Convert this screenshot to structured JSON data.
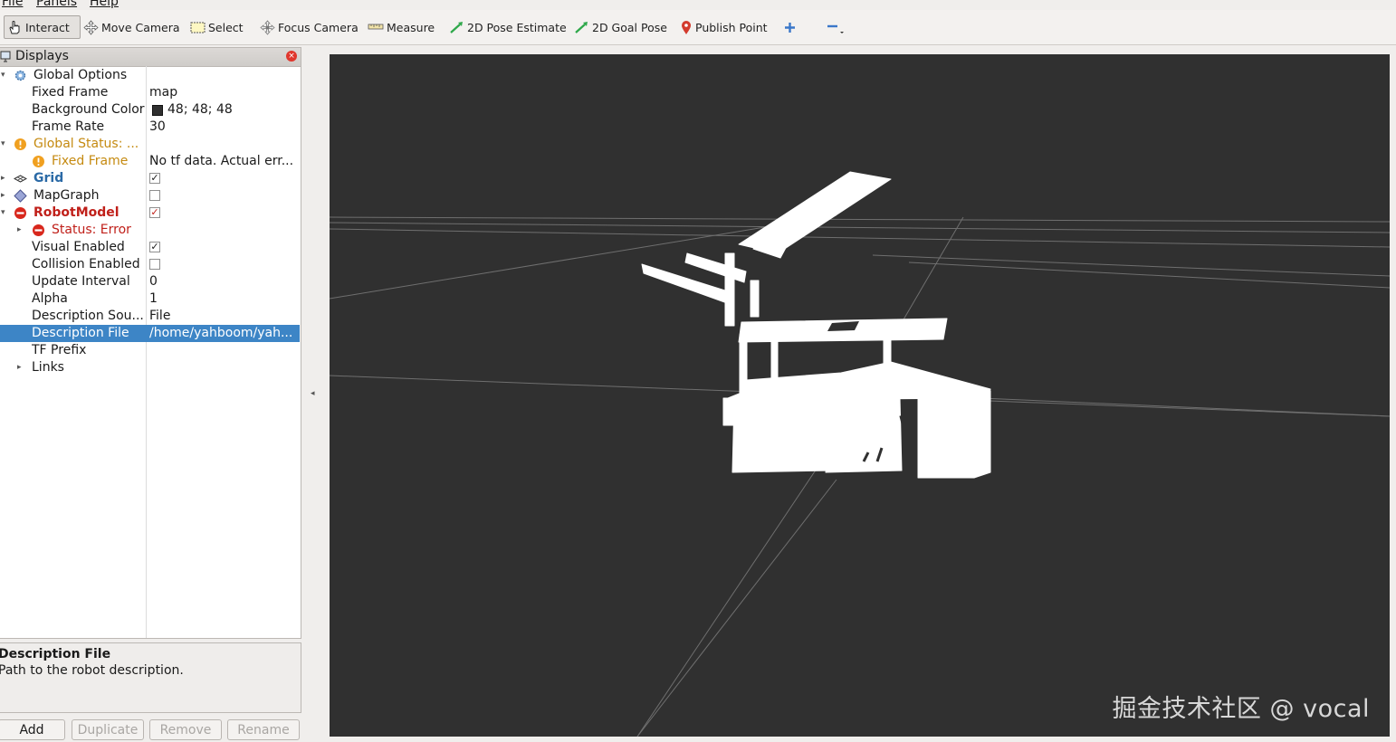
{
  "menu": {
    "items": [
      "File",
      "Panels",
      "Help"
    ]
  },
  "toolbar": {
    "interact": "Interact",
    "move_camera": "Move Camera",
    "select": "Select",
    "focus_camera": "Focus Camera",
    "measure": "Measure",
    "pose_estimate": "2D Pose Estimate",
    "goal_pose": "2D Goal Pose",
    "publish_point": "Publish Point"
  },
  "displays": {
    "title": "Displays",
    "rows": [
      {
        "name": "Global Options",
        "value": ""
      },
      {
        "name": "Fixed Frame",
        "value": "map"
      },
      {
        "name": "Background Color",
        "value": "48; 48; 48"
      },
      {
        "name": "Frame Rate",
        "value": "30"
      },
      {
        "name": "Global Status: ...",
        "value": ""
      },
      {
        "name": "Fixed Frame",
        "value": "No tf data.  Actual err..."
      },
      {
        "name": "Grid",
        "value": ""
      },
      {
        "name": "MapGraph",
        "value": ""
      },
      {
        "name": "RobotModel",
        "value": ""
      },
      {
        "name": "Status: Error",
        "value": ""
      },
      {
        "name": "Visual Enabled",
        "value": ""
      },
      {
        "name": "Collision Enabled",
        "value": ""
      },
      {
        "name": "Update Interval",
        "value": "0"
      },
      {
        "name": "Alpha",
        "value": "1"
      },
      {
        "name": "Description Sou...",
        "value": "File"
      },
      {
        "name": "Description File",
        "value": "/home/yahboom/yah..."
      },
      {
        "name": "TF Prefix",
        "value": ""
      },
      {
        "name": "Links",
        "value": ""
      }
    ],
    "checks": {
      "grid": true,
      "mapgraph": false,
      "robotmodel": true,
      "visual": true,
      "collision": false
    },
    "selected_row": 15,
    "background_color_hex": "#303030"
  },
  "description": {
    "title": "Description File",
    "text": "Path to the robot description."
  },
  "buttons": {
    "add": "Add",
    "duplicate": "Duplicate",
    "remove": "Remove",
    "rename": "Rename"
  },
  "viewport": {
    "background": "#303030",
    "watermark": "掘金技术社区 @ vocal"
  },
  "colors": {
    "selection": "#3d85c6",
    "warning": "#c58a10",
    "error": "#c0201a",
    "grid_link": "#2b6aa6"
  }
}
